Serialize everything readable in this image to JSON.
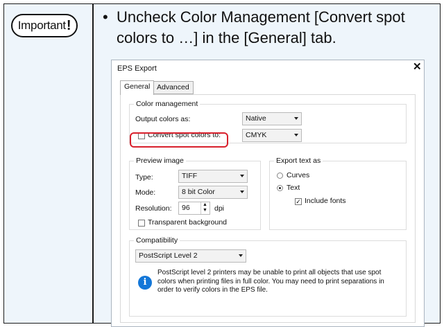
{
  "note": {
    "badge": "Important",
    "badge_mark": "!",
    "bullet": "•",
    "text": "Uncheck Color Management [Convert spot colors to …] in the [General] tab."
  },
  "dialog": {
    "title": "EPS Export",
    "close": "✕",
    "tabs": [
      "General",
      "Advanced"
    ],
    "color_management": {
      "label": "Color management",
      "output_label": "Output colors as:",
      "output_value": "Native",
      "convert_label": "Convert spot colors to:",
      "convert_checked": false,
      "convert_value": "CMYK"
    },
    "preview": {
      "label": "Preview image",
      "type_label": "Type:",
      "type_value": "TIFF",
      "mode_label": "Mode:",
      "mode_value": "8 bit Color",
      "resolution_label": "Resolution:",
      "resolution_value": "96",
      "resolution_unit": "dpi",
      "transparent_label": "Transparent background",
      "transparent_checked": false
    },
    "export_text": {
      "label": "Export text as",
      "curves_label": "Curves",
      "text_label": "Text",
      "selected": "Text",
      "include_fonts_label": "Include fonts",
      "include_fonts_checked": true
    },
    "compatibility": {
      "label": "Compatibility",
      "value": "PostScript Level 2",
      "info_icon": "i",
      "info_text": "PostScript level 2 printers may be unable to print all objects that use spot colors when printing files in full color. You may need to print separations in order to verify colors in the EPS file."
    }
  },
  "colors": {
    "highlight": "#d8202c",
    "info": "#1477d8",
    "background": "#eef5fb"
  }
}
